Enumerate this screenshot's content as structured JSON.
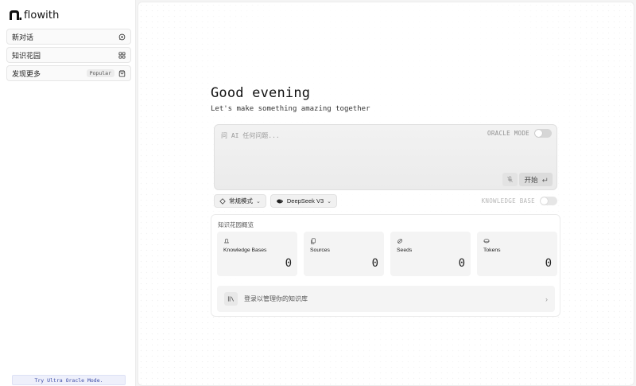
{
  "brand": {
    "name": "flowith"
  },
  "sidebar": {
    "items": [
      {
        "label": "新对话",
        "icon": "chat-plus-icon"
      },
      {
        "label": "知识花园",
        "icon": "grid-icon"
      },
      {
        "label": "发现更多",
        "icon": "bag-icon",
        "badge": "Popular"
      }
    ],
    "try_button": "Try Ultra Oracle Mode."
  },
  "main": {
    "greeting": "Good evening",
    "subline": "Let's make something amazing together",
    "prompt": {
      "placeholder": "问 AI 任何问题...",
      "oracle_label": "ORACLE MODE",
      "start_label": "开始"
    },
    "options": {
      "mode_label": "常规模式",
      "model_label": "DeepSeek V3",
      "knowledge_base_label": "KNOWLEDGE BASE"
    },
    "overview": {
      "title": "知识花园概览",
      "stats": [
        {
          "label": "Knowledge Bases",
          "value": "0",
          "icon": "bell-icon"
        },
        {
          "label": "Sources",
          "value": "0",
          "icon": "document-icon"
        },
        {
          "label": "Seeds",
          "value": "0",
          "icon": "seed-icon"
        },
        {
          "label": "Tokens",
          "value": "0",
          "icon": "token-icon"
        }
      ],
      "login_text": "登录以管理你的知识库"
    }
  }
}
